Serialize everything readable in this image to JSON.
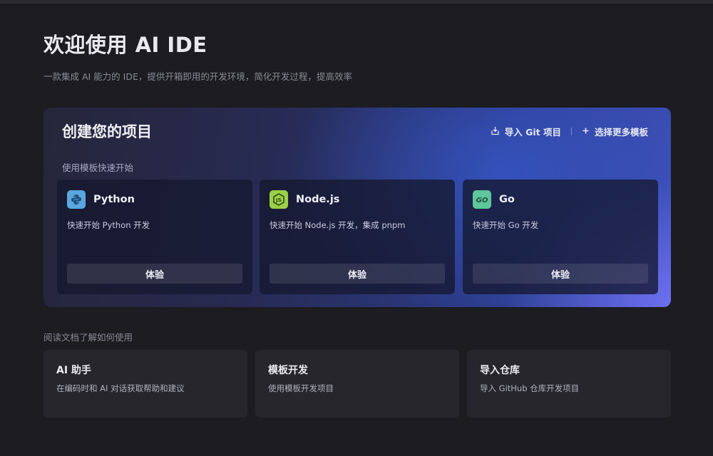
{
  "header": {
    "title": "欢迎使用 AI IDE",
    "subtitle": "一款集成 AI 能力的 IDE，提供开箱即用的开发环境，简化开发过程，提高效率"
  },
  "create": {
    "title": "创建您的项目",
    "import_git": "导入 Git 项目",
    "more_templates": "选择更多模板",
    "section_label": "使用模板快速开始",
    "templates": [
      {
        "name": "Python",
        "desc": "快速开始 Python 开发",
        "button": "体验",
        "icon": "python-icon",
        "icon_bg": "#5aa7e0"
      },
      {
        "name": "Node.js",
        "desc": "快速开始 Node.js 开发，集成 pnpm",
        "button": "体验",
        "icon": "nodejs-icon",
        "icon_bg": "#9ccf49"
      },
      {
        "name": "Go",
        "desc": "快速开始 Go 开发",
        "button": "体验",
        "icon": "go-icon",
        "icon_bg": "#5fc59a"
      }
    ]
  },
  "docs": {
    "section_label": "阅读文档了解如何使用",
    "items": [
      {
        "title": "AI 助手",
        "desc": "在编码时和 AI 对话获取帮助和建议"
      },
      {
        "title": "模板开发",
        "desc": "使用模板开发项目"
      },
      {
        "title": "导入仓库",
        "desc": "导入 GitHub 仓库开发项目"
      }
    ]
  },
  "icons": {
    "import": "import-icon",
    "plus": "plus-icon"
  }
}
